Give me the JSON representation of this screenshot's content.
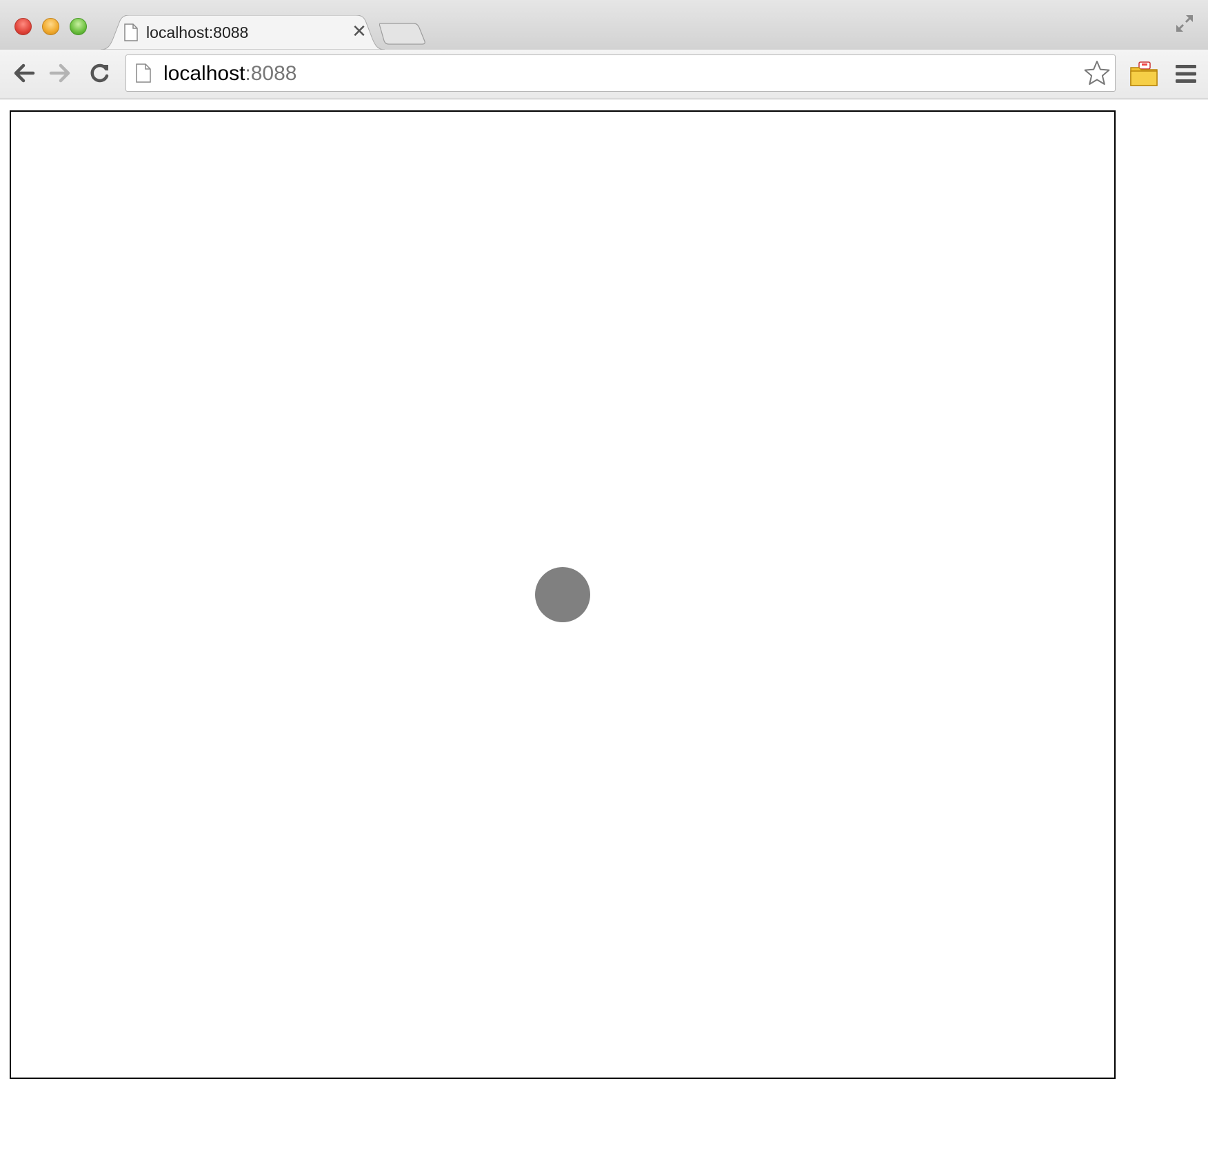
{
  "tab": {
    "title": "localhost:8088"
  },
  "address_bar": {
    "host": "localhost",
    "port": ":8088"
  },
  "icons": {
    "window_close": "window-close-icon",
    "window_minimize": "window-minimize-icon",
    "window_maximize": "window-maximize-icon",
    "tab_favicon": "page-icon",
    "tab_close": "close-icon",
    "new_tab": "new-tab-icon",
    "fullscreen": "fullscreen-icon",
    "back": "back-arrow-icon",
    "forward": "forward-arrow-icon",
    "reload": "reload-icon",
    "omnibox_favicon": "page-icon",
    "bookmark": "star-icon",
    "extension": "folder-extension-icon",
    "menu": "hamburger-menu-icon"
  },
  "page": {
    "ball_color": "#808080",
    "frame_border_color": "#000000"
  }
}
